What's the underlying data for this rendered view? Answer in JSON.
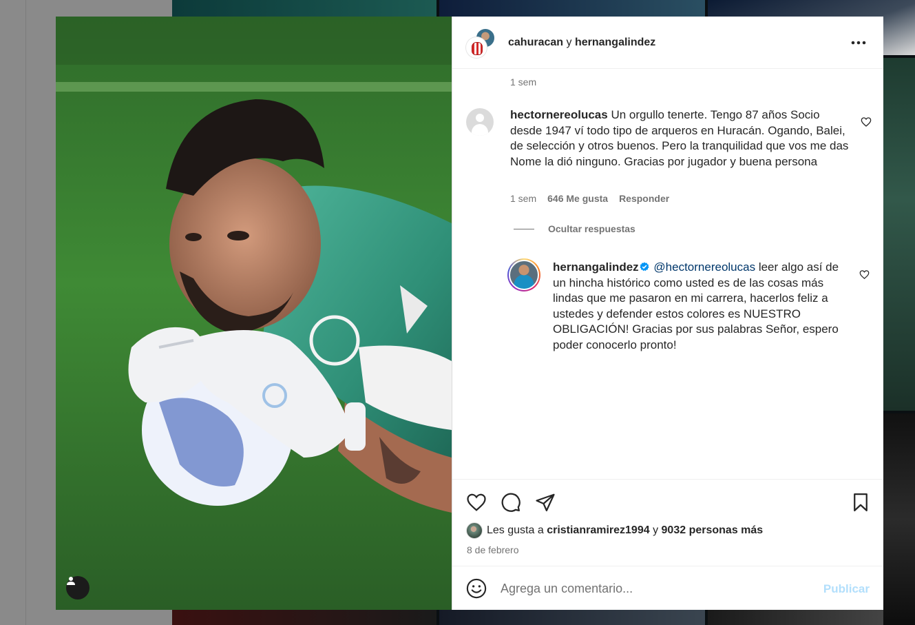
{
  "post": {
    "header": {
      "author1": "cahuracan",
      "separator": "y",
      "author2": "hernangalindez"
    },
    "top_time": "1 sem",
    "comment": {
      "username": "hectornereolucas",
      "text": "Un orgullo tenerte. Tengo 87 años Socio desde 1947 ví todo tipo de arqueros en Huracán. Ogando, Balei, de selección y otros buenos. Pero la tranquilidad que vos me das Nome la dió ninguno. Gracias por jugador y buena persona",
      "time": "1 sem",
      "likes": "646 Me gusta",
      "reply_label": "Responder"
    },
    "hide_replies_label": "Ocultar respuestas",
    "reply": {
      "username": "hernangalindez",
      "mention": "@hectornereolucas",
      "text": "leer algo así de un hincha histórico como usted es de las cosas más lindas que me pasaron en mi carrera, hacerlos feliz a ustedes y defender estos colores es NUESTRO OBLIGACIÓN! Gracias por sus palabras Señor, espero poder conocerlo pronto!"
    },
    "likes_summary": {
      "prefix": "Les gusta a",
      "liker": "cristianramirez1994",
      "conj": "y",
      "others": "9032 personas más"
    },
    "date": "8 de febrero",
    "add_comment": {
      "placeholder": "Agrega un comentario...",
      "publish_label": "Publicar"
    }
  },
  "icons": [
    "more-options-icon",
    "heart-icon",
    "comment-icon",
    "share-icon",
    "bookmark-icon",
    "emoji-icon",
    "verified-badge-icon",
    "user-tag-icon"
  ],
  "colors": {
    "text": "#262626",
    "secondary": "#737373",
    "mention": "#00376b",
    "publish_disabled": "#b2dffc",
    "verified": "#0095f6"
  }
}
